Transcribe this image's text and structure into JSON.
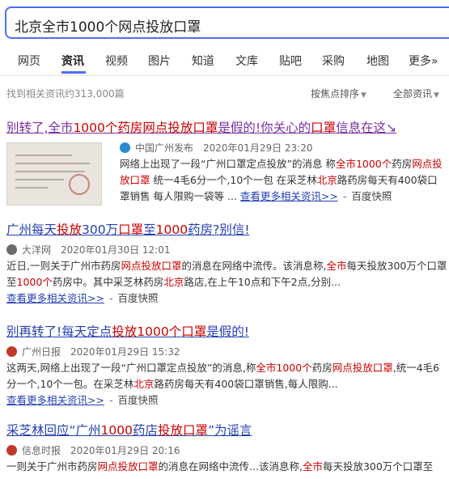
{
  "search": {
    "query": "北京全市1000个网点投放口罩"
  },
  "tabs": [
    "网页",
    "资讯",
    "视频",
    "图片",
    "知道",
    "文库",
    "贴吧",
    "采购",
    "地图",
    "更多»"
  ],
  "active_tab": "资讯",
  "toolbar": {
    "result_count": "找到相关资讯约313,000篇",
    "sort_label": "按焦点排序",
    "filter_label": "全部资讯"
  },
  "colors": {
    "accent": "#4e6ef2",
    "link": "#2440b3",
    "visited": "#7a2ea0",
    "highlight": "#cc0000"
  },
  "results": [
    {
      "title_parts": [
        "别转了,全市",
        "1000个药房",
        "网点投放",
        "口罩",
        "是假的!你关心的",
        "口罩",
        "信息在这↘"
      ],
      "source_icon": "globe-icon",
      "source": "中国广州发布",
      "date": "2020年01月29日 23:20",
      "snippet_parts": [
        "网络上出现了一段“广州口罩定点投放”的消息 称",
        "全市1000个",
        "药房",
        "网点投放口罩",
        " 统一4毛6分一个,10个一包 在采芝林",
        "北京",
        "路药房每天有400袋口罩销售 每人限购一袋等 ..."
      ],
      "more_link": "查看更多相关资讯>>",
      "snapshot": "百度快照"
    },
    {
      "title_parts": [
        "广州每天",
        "投放",
        "300万",
        "口罩",
        "至",
        "1000",
        "药房?别信!"
      ],
      "source_icon": "newspaper-icon",
      "source": "大洋网",
      "date": "2020年01月30日 12:01",
      "snippet_parts": [
        "近日,一则关于广州市药房",
        "网点投放口罩",
        "的消息在网络中流传。该消息称,",
        "全市",
        "每天投放300万个口罩至",
        "1000个",
        "药房中。其中采芝林药房",
        "北京",
        "路店,在上午10点和下午2点,分别..."
      ],
      "more_link": "查看更多相关资讯>>",
      "snapshot": "百度快照"
    },
    {
      "title_parts": [
        "别再转了!每天定点",
        "投放",
        "1000个",
        "口罩",
        "是假的!"
      ],
      "source_icon": "newspaper-red-icon",
      "source": "广州日报",
      "date": "2020年01月29日 15:32",
      "snippet_parts": [
        "这两天,网络上出现了一段“广州口罩定点投放”的消息,称",
        "全市1000个",
        "药房",
        "网点投放口罩",
        ",统一4毛6分一个,10个一包。在采芝林",
        "北京",
        "路药房每天有400袋口罩销售,每人限购..."
      ],
      "more_link": "查看更多相关资讯>>",
      "snapshot": "百度快照"
    },
    {
      "title_parts": [
        "采芝林回应“广州",
        "1000",
        "药店",
        "投放口罩",
        "”为谣言"
      ],
      "source_icon": "newspaper-red-icon",
      "source": "信息时报",
      "date": "2020年01月29日 20:16",
      "snippet_parts": [
        "一则关于广州市药房",
        "网点投放口罩",
        "的消息在网络中流传...该消息称,",
        "全市",
        "每天投放300万个口罩至"
      ]
    }
  ]
}
